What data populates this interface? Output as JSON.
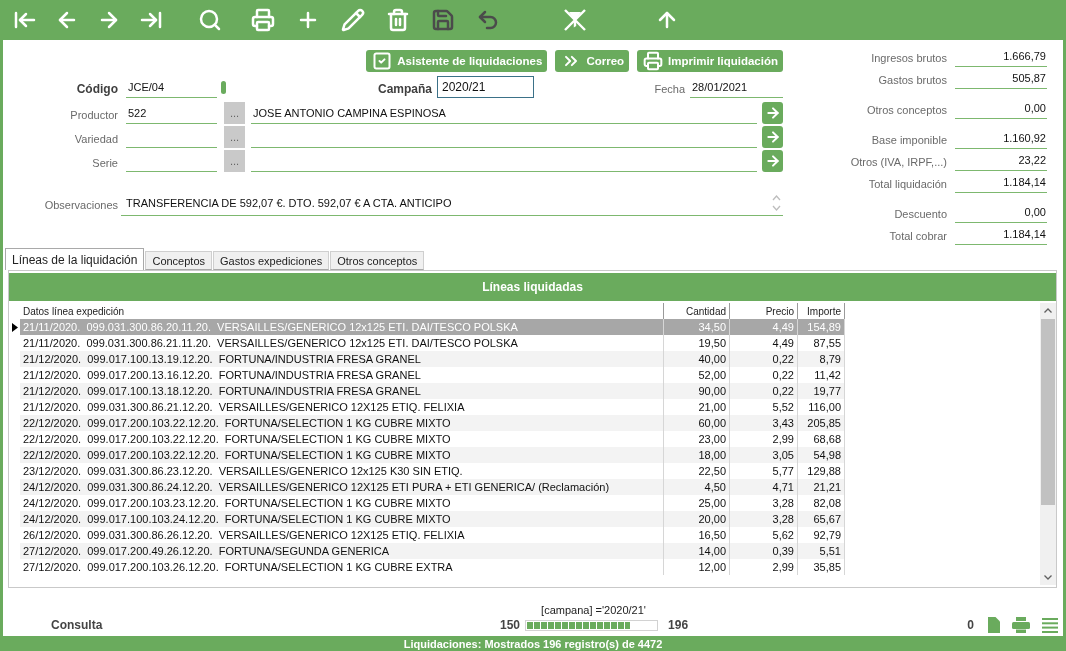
{
  "toolbar": {
    "groups": [
      [
        {
          "disabled": false
        },
        {
          "disabled": false
        },
        {
          "disabled": false
        },
        {
          "disabled": false
        }
      ],
      [
        {
          "disabled": false
        }
      ],
      [
        {
          "disabled": false
        },
        {
          "disabled": false
        },
        {
          "disabled": false
        },
        {
          "disabled": false
        },
        {
          "disabled": true
        },
        {
          "disabled": true
        }
      ],
      [
        {
          "disabled": false
        }
      ],
      [
        {
          "disabled": false
        }
      ]
    ]
  },
  "actions": [
    {
      "label": "Asistente de liquidaciones"
    },
    {
      "label": "Correo"
    },
    {
      "label": "Imprimir liquidación"
    }
  ],
  "header": {
    "code": {
      "label": "Código",
      "value": "JCE/04"
    },
    "campaign": {
      "label": "Campaña",
      "value": "2020/21"
    },
    "date": {
      "label": "Fecha",
      "value": "28/01/2021"
    }
  },
  "lookups": [
    {
      "label": "Productor",
      "code": "522",
      "browse": "...",
      "name": "JOSE ANTONIO CAMPINA ESPINOSA"
    },
    {
      "label": "Variedad",
      "browse": "..."
    },
    {
      "label": "Serie",
      "browse": "..."
    }
  ],
  "notes": {
    "label": "Observaciones",
    "value": "TRANSFERENCIA DE 592,07 €. DTO. 592,07 € A CTA. ANTICIPO"
  },
  "totals": [
    {
      "items": [
        {
          "label": "Ingresos brutos",
          "value": "1.666,79"
        },
        {
          "label": "Gastos brutos",
          "value": "505,87"
        }
      ]
    },
    {
      "items": [
        {
          "label": "Otros conceptos",
          "value": "0,00"
        }
      ]
    },
    {
      "items": [
        {
          "label": "Base imponible",
          "value": "1.160,92"
        },
        {
          "label": "Otros (IVA, IRPF,...)",
          "value": "23,22"
        },
        {
          "label": "Total liquidación",
          "value": "1.184,14"
        }
      ]
    },
    {
      "items": [
        {
          "label": "Descuento",
          "value": "0,00"
        },
        {
          "label": "Total cobrar",
          "value": "1.184,14"
        }
      ]
    }
  ],
  "tabs": [
    {
      "label": "Líneas de la liquidación",
      "selected": true
    },
    {
      "label": "Conceptos",
      "selected": false
    },
    {
      "label": "Gastos expediciones",
      "selected": false
    },
    {
      "label": "Otros conceptos",
      "selected": false
    }
  ],
  "grid": {
    "title": "Líneas liquidadas",
    "columns": [
      "Datos línea expedición",
      "Cantidad",
      "Precio",
      "Importe"
    ],
    "rows": [
      {
        "selected": true,
        "cells": [
          "21/11/2020.  099.031.300.86.20.11.20.  VERSAILLES/GENERICO 12x125 ETI. DAI/TESCO POLSKA",
          "34,50",
          "4,49",
          "154,89"
        ]
      },
      {
        "selected": false,
        "cells": [
          "21/11/2020.  099.031.300.86.21.11.20.  VERSAILLES/GENERICO 12x125 ETI. DAI/TESCO POLSKA",
          "19,50",
          "4,49",
          "87,55"
        ]
      },
      {
        "selected": false,
        "cells": [
          "21/12/2020.  099.017.100.13.19.12.20.  FORTUNA/INDUSTRIA FRESA GRANEL",
          "40,00",
          "0,22",
          "8,79"
        ]
      },
      {
        "selected": false,
        "cells": [
          "21/12/2020.  099.017.200.13.16.12.20.  FORTUNA/INDUSTRIA FRESA GRANEL",
          "52,00",
          "0,22",
          "11,42"
        ]
      },
      {
        "selected": false,
        "cells": [
          "21/12/2020.  099.017.100.13.18.12.20.  FORTUNA/INDUSTRIA FRESA GRANEL",
          "90,00",
          "0,22",
          "19,77"
        ]
      },
      {
        "selected": false,
        "cells": [
          "21/12/2020.  099.031.300.86.21.12.20.  VERSAILLES/GENERICO 12X125 ETIQ. FELIXIA",
          "21,00",
          "5,52",
          "116,00"
        ]
      },
      {
        "selected": false,
        "cells": [
          "22/12/2020.  099.017.200.103.22.12.20.  FORTUNA/SELECTION 1 KG CUBRE MIXTO",
          "60,00",
          "3,43",
          "205,85"
        ]
      },
      {
        "selected": false,
        "cells": [
          "22/12/2020.  099.017.200.103.22.12.20.  FORTUNA/SELECTION 1 KG CUBRE MIXTO",
          "23,00",
          "2,99",
          "68,68"
        ]
      },
      {
        "selected": false,
        "cells": [
          "22/12/2020.  099.017.200.103.22.12.20.  FORTUNA/SELECTION 1 KG CUBRE MIXTO",
          "18,00",
          "3,05",
          "54,98"
        ]
      },
      {
        "selected": false,
        "cells": [
          "23/12/2020.  099.031.300.86.23.12.20.  VERSAILLES/GENERICO 12x125 K30 SIN ETIQ.",
          "22,50",
          "5,77",
          "129,88"
        ]
      },
      {
        "selected": false,
        "cells": [
          "24/12/2020.  099.031.300.86.24.12.20.  VERSAILLES/GENERICO 12X125 ETI PURA + ETI GENERICA/ (Reclamación)",
          "4,50",
          "4,71",
          "21,21"
        ]
      },
      {
        "selected": false,
        "cells": [
          "24/12/2020.  099.017.200.103.23.12.20.  FORTUNA/SELECTION 1 KG CUBRE MIXTO",
          "25,00",
          "3,28",
          "82,08"
        ]
      },
      {
        "selected": false,
        "cells": [
          "24/12/2020.  099.017.100.103.24.12.20.  FORTUNA/SELECTION 1 KG CUBRE MIXTO",
          "20,00",
          "3,28",
          "65,67"
        ]
      },
      {
        "selected": false,
        "cells": [
          "26/12/2020.  099.031.300.86.26.12.20.  VERSAILLES/GENERICO 12X125 ETIQ. FELIXIA",
          "16,50",
          "5,62",
          "92,79"
        ]
      },
      {
        "selected": false,
        "cells": [
          "27/12/2020.  099.017.200.49.26.12.20.  FORTUNA/SEGUNDA GENERICA",
          "14,00",
          "0,39",
          "5,51"
        ]
      },
      {
        "selected": false,
        "cells": [
          "27/12/2020.  099.017.200.103.26.12.20.  FORTUNA/SELECTION 1 KG CUBRE EXTRA",
          "12,00",
          "2,99",
          "35,85"
        ]
      }
    ]
  },
  "footer": {
    "mode": "Consulta",
    "filter": "[campana] ='2020/21'",
    "from": "150",
    "to": "196",
    "level": 0.8,
    "count": "0"
  },
  "status_bar": "Liquidaciones: Mostrados 196 registro(s) de 4472"
}
